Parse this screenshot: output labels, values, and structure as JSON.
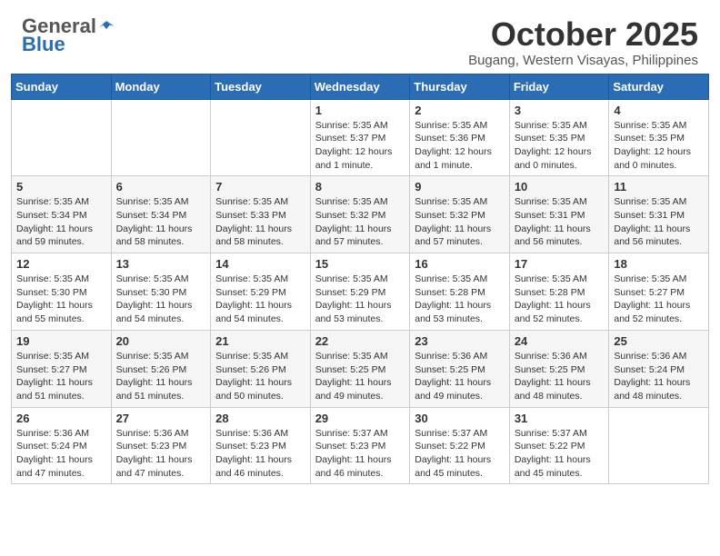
{
  "header": {
    "logo_general": "General",
    "logo_blue": "Blue",
    "month_title": "October 2025",
    "location": "Bugang, Western Visayas, Philippines"
  },
  "days_of_week": [
    "Sunday",
    "Monday",
    "Tuesday",
    "Wednesday",
    "Thursday",
    "Friday",
    "Saturday"
  ],
  "weeks": [
    [
      {
        "day": "",
        "info": ""
      },
      {
        "day": "",
        "info": ""
      },
      {
        "day": "",
        "info": ""
      },
      {
        "day": "1",
        "info": "Sunrise: 5:35 AM\nSunset: 5:37 PM\nDaylight: 12 hours\nand 1 minute."
      },
      {
        "day": "2",
        "info": "Sunrise: 5:35 AM\nSunset: 5:36 PM\nDaylight: 12 hours\nand 1 minute."
      },
      {
        "day": "3",
        "info": "Sunrise: 5:35 AM\nSunset: 5:35 PM\nDaylight: 12 hours\nand 0 minutes."
      },
      {
        "day": "4",
        "info": "Sunrise: 5:35 AM\nSunset: 5:35 PM\nDaylight: 12 hours\nand 0 minutes."
      }
    ],
    [
      {
        "day": "5",
        "info": "Sunrise: 5:35 AM\nSunset: 5:34 PM\nDaylight: 11 hours\nand 59 minutes."
      },
      {
        "day": "6",
        "info": "Sunrise: 5:35 AM\nSunset: 5:34 PM\nDaylight: 11 hours\nand 58 minutes."
      },
      {
        "day": "7",
        "info": "Sunrise: 5:35 AM\nSunset: 5:33 PM\nDaylight: 11 hours\nand 58 minutes."
      },
      {
        "day": "8",
        "info": "Sunrise: 5:35 AM\nSunset: 5:32 PM\nDaylight: 11 hours\nand 57 minutes."
      },
      {
        "day": "9",
        "info": "Sunrise: 5:35 AM\nSunset: 5:32 PM\nDaylight: 11 hours\nand 57 minutes."
      },
      {
        "day": "10",
        "info": "Sunrise: 5:35 AM\nSunset: 5:31 PM\nDaylight: 11 hours\nand 56 minutes."
      },
      {
        "day": "11",
        "info": "Sunrise: 5:35 AM\nSunset: 5:31 PM\nDaylight: 11 hours\nand 56 minutes."
      }
    ],
    [
      {
        "day": "12",
        "info": "Sunrise: 5:35 AM\nSunset: 5:30 PM\nDaylight: 11 hours\nand 55 minutes."
      },
      {
        "day": "13",
        "info": "Sunrise: 5:35 AM\nSunset: 5:30 PM\nDaylight: 11 hours\nand 54 minutes."
      },
      {
        "day": "14",
        "info": "Sunrise: 5:35 AM\nSunset: 5:29 PM\nDaylight: 11 hours\nand 54 minutes."
      },
      {
        "day": "15",
        "info": "Sunrise: 5:35 AM\nSunset: 5:29 PM\nDaylight: 11 hours\nand 53 minutes."
      },
      {
        "day": "16",
        "info": "Sunrise: 5:35 AM\nSunset: 5:28 PM\nDaylight: 11 hours\nand 53 minutes."
      },
      {
        "day": "17",
        "info": "Sunrise: 5:35 AM\nSunset: 5:28 PM\nDaylight: 11 hours\nand 52 minutes."
      },
      {
        "day": "18",
        "info": "Sunrise: 5:35 AM\nSunset: 5:27 PM\nDaylight: 11 hours\nand 52 minutes."
      }
    ],
    [
      {
        "day": "19",
        "info": "Sunrise: 5:35 AM\nSunset: 5:27 PM\nDaylight: 11 hours\nand 51 minutes."
      },
      {
        "day": "20",
        "info": "Sunrise: 5:35 AM\nSunset: 5:26 PM\nDaylight: 11 hours\nand 51 minutes."
      },
      {
        "day": "21",
        "info": "Sunrise: 5:35 AM\nSunset: 5:26 PM\nDaylight: 11 hours\nand 50 minutes."
      },
      {
        "day": "22",
        "info": "Sunrise: 5:35 AM\nSunset: 5:25 PM\nDaylight: 11 hours\nand 49 minutes."
      },
      {
        "day": "23",
        "info": "Sunrise: 5:36 AM\nSunset: 5:25 PM\nDaylight: 11 hours\nand 49 minutes."
      },
      {
        "day": "24",
        "info": "Sunrise: 5:36 AM\nSunset: 5:25 PM\nDaylight: 11 hours\nand 48 minutes."
      },
      {
        "day": "25",
        "info": "Sunrise: 5:36 AM\nSunset: 5:24 PM\nDaylight: 11 hours\nand 48 minutes."
      }
    ],
    [
      {
        "day": "26",
        "info": "Sunrise: 5:36 AM\nSunset: 5:24 PM\nDaylight: 11 hours\nand 47 minutes."
      },
      {
        "day": "27",
        "info": "Sunrise: 5:36 AM\nSunset: 5:23 PM\nDaylight: 11 hours\nand 47 minutes."
      },
      {
        "day": "28",
        "info": "Sunrise: 5:36 AM\nSunset: 5:23 PM\nDaylight: 11 hours\nand 46 minutes."
      },
      {
        "day": "29",
        "info": "Sunrise: 5:37 AM\nSunset: 5:23 PM\nDaylight: 11 hours\nand 46 minutes."
      },
      {
        "day": "30",
        "info": "Sunrise: 5:37 AM\nSunset: 5:22 PM\nDaylight: 11 hours\nand 45 minutes."
      },
      {
        "day": "31",
        "info": "Sunrise: 5:37 AM\nSunset: 5:22 PM\nDaylight: 11 hours\nand 45 minutes."
      },
      {
        "day": "",
        "info": ""
      }
    ]
  ]
}
